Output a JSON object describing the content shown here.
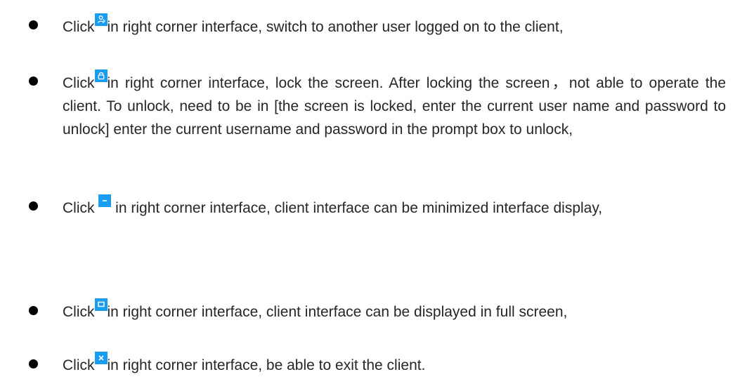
{
  "bullets": [
    {
      "icon": "switch-user-icon",
      "before": "Click",
      "after": "in right corner interface, switch to another user logged on to the client,"
    },
    {
      "icon": "lock-icon",
      "before": "Click",
      "after": "in right corner interface, lock the screen. After locking the screen，not able to operate the client. To unlock, need to be in [the screen is locked, enter the current user name and password to unlock] enter the current username and password in the prompt box to unlock,"
    },
    {
      "icon": "minimize-icon",
      "before": "Click ",
      "after": " in right corner interface, client interface can be minimized interface display,"
    },
    {
      "icon": "fullscreen-icon",
      "before": "Click",
      "after": "in right corner interface, client interface can be displayed in full screen,"
    },
    {
      "icon": "close-icon",
      "before": "Click",
      "after": "in right corner interface, be able to exit the client."
    }
  ],
  "colors": {
    "text": "#262626",
    "icon_background": "#1a9cf0",
    "icon_glyph": "#ffffff",
    "bullet": "#000000"
  }
}
